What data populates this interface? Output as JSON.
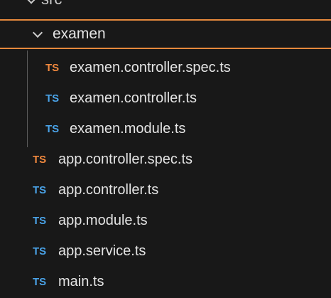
{
  "explorer": {
    "parent_folder_label": "src",
    "folder": {
      "label": "examen",
      "expanded": true,
      "highlight_color": "#e6893c",
      "files": [
        {
          "name": "examen.controller.spec.ts",
          "icon_text": "TS",
          "icon": "typescript-test-icon",
          "icon_color": "#f0883e"
        },
        {
          "name": "examen.controller.ts",
          "icon_text": "TS",
          "icon": "typescript-icon",
          "icon_color": "#4aa3e8"
        },
        {
          "name": "examen.module.ts",
          "icon_text": "TS",
          "icon": "typescript-icon",
          "icon_color": "#4aa3e8"
        }
      ]
    },
    "files": [
      {
        "name": "app.controller.spec.ts",
        "icon_text": "TS",
        "icon": "typescript-test-icon",
        "icon_color": "#f0883e"
      },
      {
        "name": "app.controller.ts",
        "icon_text": "TS",
        "icon": "typescript-icon",
        "icon_color": "#4aa3e8"
      },
      {
        "name": "app.module.ts",
        "icon_text": "TS",
        "icon": "typescript-icon",
        "icon_color": "#4aa3e8"
      },
      {
        "name": "app.service.ts",
        "icon_text": "TS",
        "icon": "typescript-icon",
        "icon_color": "#4aa3e8"
      },
      {
        "name": "main.ts",
        "icon_text": "TS",
        "icon": "typescript-icon",
        "icon_color": "#4aa3e8"
      }
    ]
  }
}
